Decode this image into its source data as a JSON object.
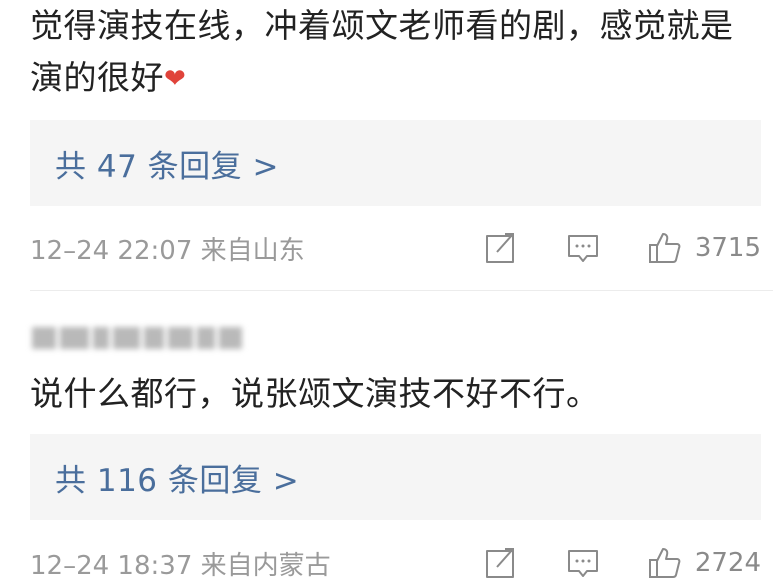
{
  "comments": [
    {
      "text": "觉得演技在线，冲着颂文老师看的剧，感觉就是演的很好",
      "emoji": "❤",
      "reply_link": "共 47 条回复 >",
      "timestamp": "12–24 22:07 来自山东",
      "likes": "3715"
    },
    {
      "username": "",
      "text": "说什么都行，说张颂文演技不好不行。",
      "reply_link": "共 116 条回复 >",
      "timestamp": "12–24 18:37 来自内蒙古",
      "likes": "2724"
    }
  ],
  "icons": {
    "share": "share-icon",
    "comment": "comment-icon",
    "like": "thumbs-up-icon"
  },
  "colors": {
    "link": "#4a6e9c",
    "meta_text": "#9a9a9a",
    "reply_bg": "#f5f5f5",
    "heart": "#e0433a"
  }
}
